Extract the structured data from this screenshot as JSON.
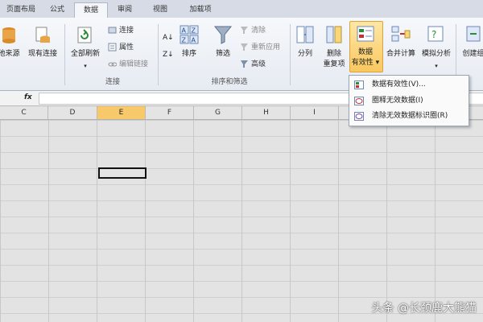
{
  "tabs": [
    "页面布局",
    "公式",
    "数据",
    "审阅",
    "视图",
    "加载项"
  ],
  "ribbon": {
    "get_external": {
      "from_source": "他来源",
      "existing_conn": "现有连接"
    },
    "connections": {
      "refresh_all": "全部刷新",
      "connections": "连接",
      "properties": "属性",
      "edit_links": "编辑链接",
      "group_label": "连接"
    },
    "sort_filter": {
      "sort_az": "A↓Z",
      "sort": "排序",
      "filter": "筛选",
      "clear": "清除",
      "reapply": "重新应用",
      "advanced": "高级",
      "group_label": "排序和筛选"
    },
    "data_tools": {
      "text_to_columns": "分列",
      "remove_dup_1": "删除",
      "remove_dup_2": "重复项",
      "validation_1": "数据",
      "validation_2": "有效性",
      "consolidate": "合并计算",
      "whatif": "模拟分析",
      "group_1": "创建组"
    }
  },
  "formula_bar": {
    "fx": "fx"
  },
  "columns": [
    "C",
    "D",
    "E",
    "F",
    "G",
    "H",
    "I"
  ],
  "selected_column": "E",
  "menu": {
    "items": [
      "数据有效性(V)...",
      "圈释无效数据(I)",
      "清除无效数据标识圈(R)"
    ]
  },
  "watermark": "头条 @长颈鹿大熊猫",
  "colors": {
    "highlight": "#f9c85e",
    "ribbon": "#eef1f6"
  }
}
